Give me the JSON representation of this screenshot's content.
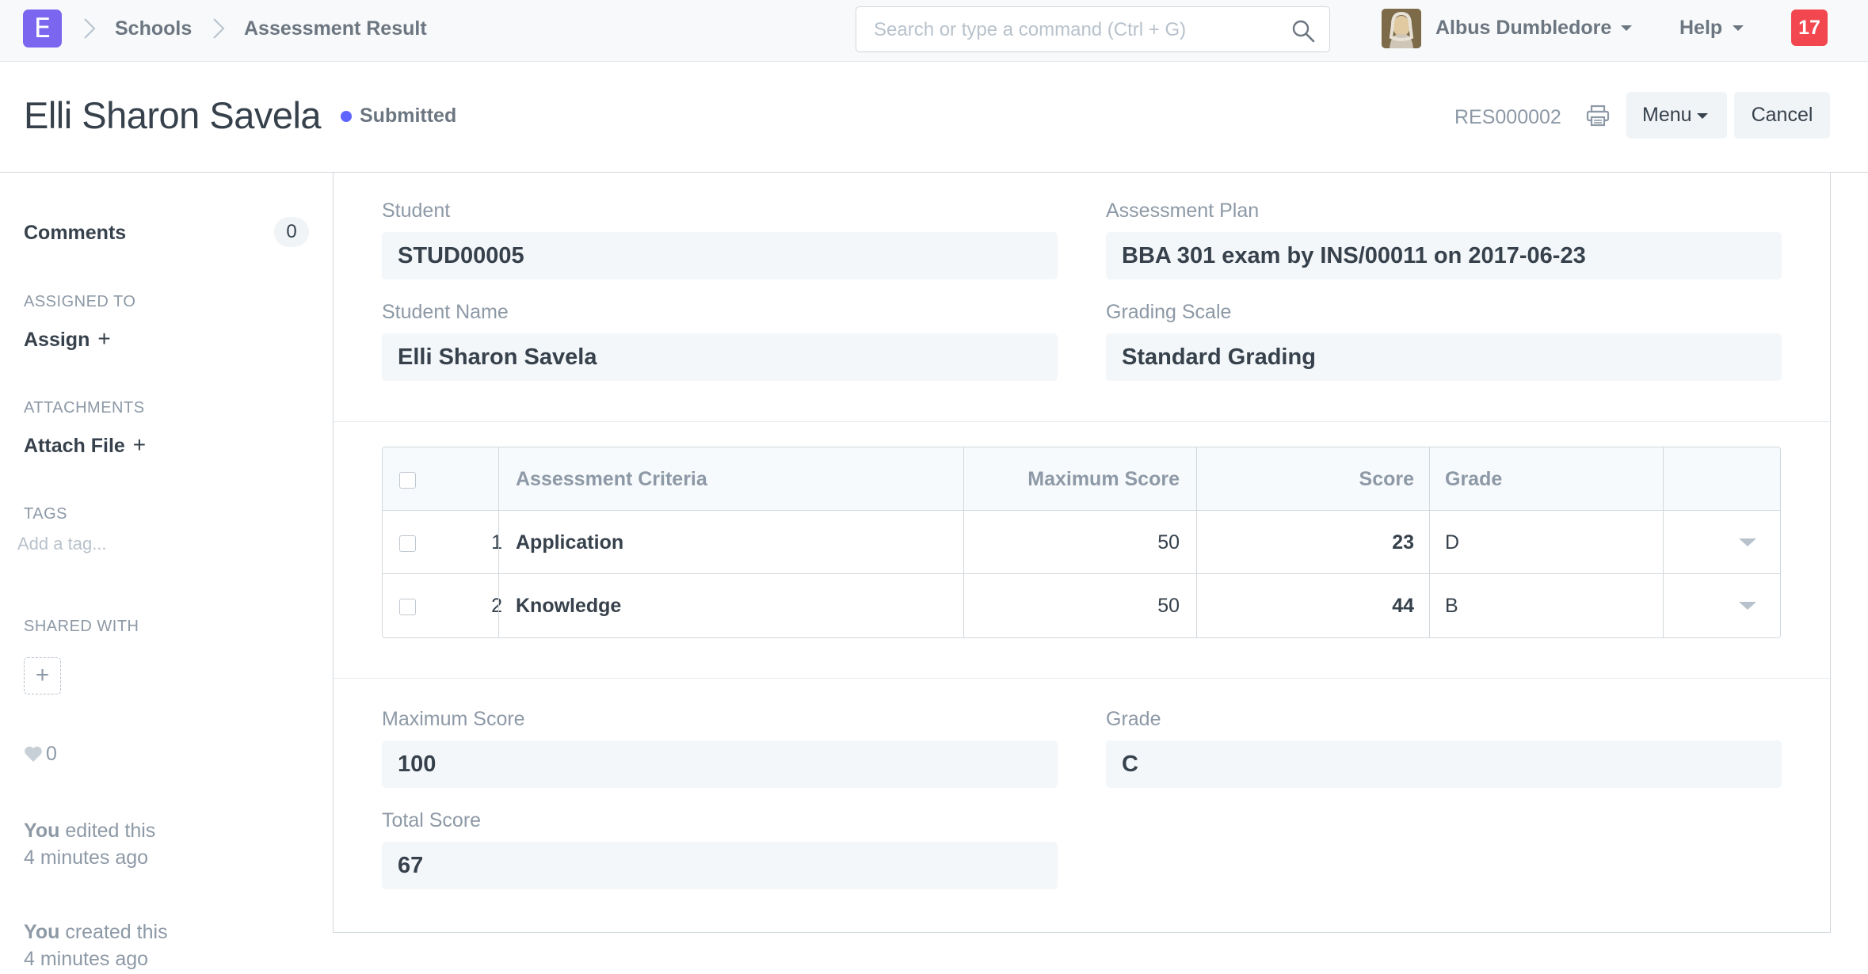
{
  "navbar": {
    "logo_letter": "E",
    "breadcrumbs": [
      "Schools",
      "Assessment Result"
    ],
    "search_placeholder": "Search or type a command (Ctrl + G)",
    "user_name": "Albus Dumbledore",
    "help_label": "Help",
    "notification_count": "17"
  },
  "page": {
    "title": "Elli Sharon Savela",
    "status": "Submitted",
    "status_color": "#5e64ff",
    "doc_id": "RES000002",
    "menu_label": "Menu",
    "cancel_label": "Cancel"
  },
  "sidebar": {
    "comments_label": "Comments",
    "comments_count": "0",
    "assigned_heading": "ASSIGNED TO",
    "assign_label": "Assign",
    "attachments_heading": "ATTACHMENTS",
    "attach_label": "Attach File",
    "tags_heading": "TAGS",
    "tag_placeholder": "Add a tag...",
    "shared_heading": "SHARED WITH",
    "likes": "0",
    "activity": [
      {
        "who": "You",
        "what": "edited this",
        "when": "4 minutes ago"
      },
      {
        "who": "You",
        "what": "created this",
        "when": "4 minutes ago"
      }
    ]
  },
  "form": {
    "student": {
      "label": "Student",
      "value": "STUD00005"
    },
    "assessment_plan": {
      "label": "Assessment Plan",
      "value": "BBA 301 exam by INS/00011 on 2017-06-23"
    },
    "student_name": {
      "label": "Student Name",
      "value": "Elli Sharon Savela"
    },
    "grading_scale": {
      "label": "Grading Scale",
      "value": "Standard Grading"
    },
    "maximum_score": {
      "label": "Maximum Score",
      "value": "100"
    },
    "grade": {
      "label": "Grade",
      "value": "C"
    },
    "total_score": {
      "label": "Total Score",
      "value": "67"
    }
  },
  "grid": {
    "columns": [
      "Assessment Criteria",
      "Maximum Score",
      "Score",
      "Grade"
    ],
    "rows": [
      {
        "idx": "1",
        "criteria": "Application",
        "max_score": "50",
        "score": "23",
        "grade": "D"
      },
      {
        "idx": "2",
        "criteria": "Knowledge",
        "max_score": "50",
        "score": "44",
        "grade": "B"
      }
    ]
  }
}
